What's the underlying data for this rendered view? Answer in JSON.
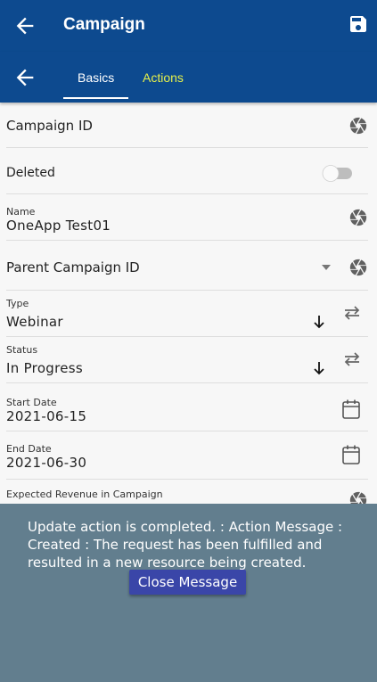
{
  "app_bar": {
    "title": "Campaign",
    "back_icon": "arrow-left-icon",
    "save_icon": "save-icon"
  },
  "tabs": [
    {
      "label": "Basics",
      "active": true
    },
    {
      "label": "Actions",
      "active": false
    }
  ],
  "fields": {
    "campaign_id": {
      "label": "Campaign ID"
    },
    "deleted": {
      "label": "Deleted",
      "on": false
    },
    "name": {
      "label": "Name",
      "value": "OneApp Test01"
    },
    "parent_campaign_id": {
      "label": "Parent Campaign ID"
    },
    "type": {
      "label": "Type",
      "value": "Webinar"
    },
    "status": {
      "label": "Status",
      "value": "In Progress"
    },
    "start_date": {
      "label": "Start Date",
      "value": "2021-06-15"
    },
    "end_date": {
      "label": "End Date",
      "value": "2021-06-30"
    },
    "expected_revenue": {
      "label": "Expected Revenue in Campaign"
    }
  },
  "message": {
    "text": "Update action is completed.  : Action Message : Created : The request has been fulfilled and resulted in a new resource being created.",
    "close_label": "Close Message"
  },
  "colors": {
    "primary": "#0d4a8f",
    "tab_inactive": "#e6f04a",
    "overlay": "#627e8e",
    "button": "#3a46a8"
  }
}
